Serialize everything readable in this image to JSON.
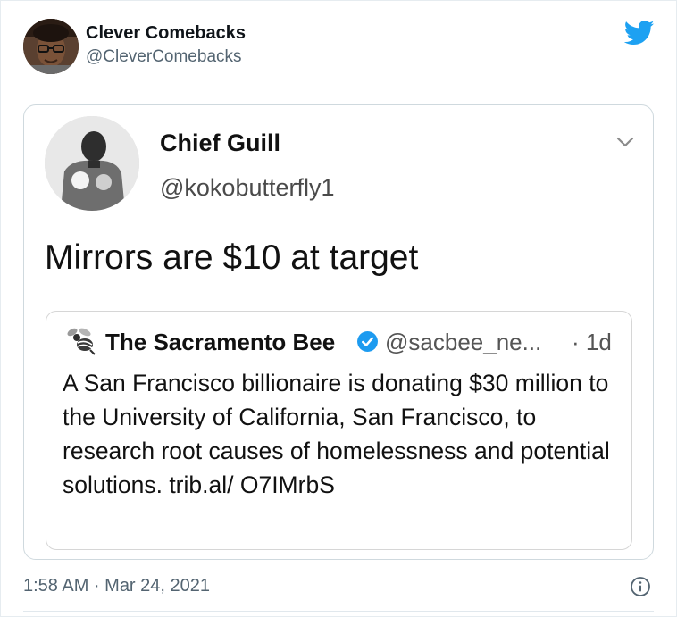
{
  "tweet": {
    "user_name": "Clever Comebacks",
    "user_handle": "@CleverComebacks",
    "timestamp": "1:58 AM · Mar 24, 2021"
  },
  "quoted": {
    "name": "Chief Guill",
    "handle": "@kokobutterfly1",
    "text": "Mirrors are $10 at target"
  },
  "embedded": {
    "name": "The Sacramento Bee",
    "handle": "@sacbee_ne...",
    "time": "· 1d",
    "text": "A San Francisco billionaire is donating $30 million to the University of California, San Francisco, to research root causes of homelessness and potential solutions. trib.al/ O7IMrbS"
  },
  "icons": {
    "brand": "twitter-bird-icon",
    "menu": "chevron-down-icon",
    "verified": "verified-badge-icon",
    "info": "info-icon"
  },
  "colors": {
    "twitter_blue": "#1da1f2",
    "secondary_text": "#536471",
    "verified_blue": "#1d9bf0"
  }
}
